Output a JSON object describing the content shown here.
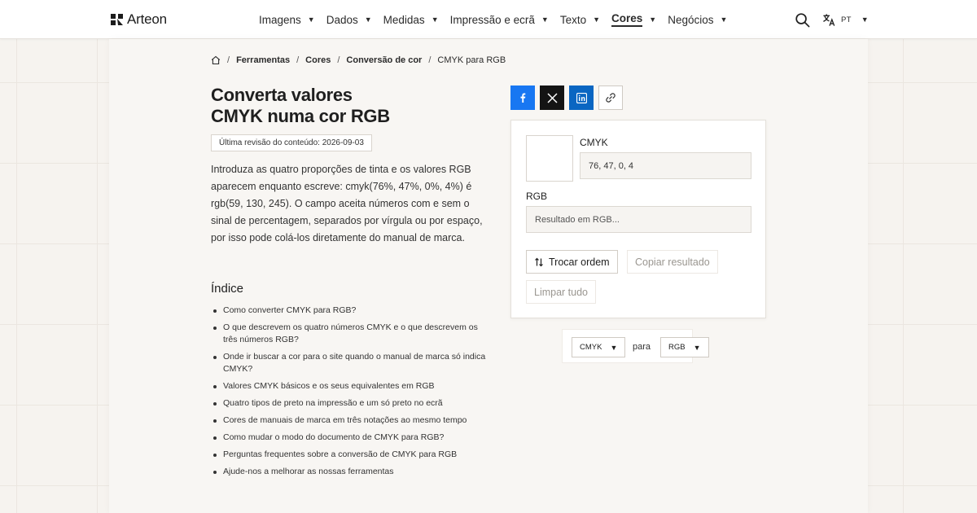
{
  "header": {
    "logo_text": "Arteon",
    "nav": [
      {
        "label": "Imagens"
      },
      {
        "label": "Dados"
      },
      {
        "label": "Medidas"
      },
      {
        "label": "Impressão e ecrã"
      },
      {
        "label": "Texto"
      },
      {
        "label": "Cores",
        "active": true
      },
      {
        "label": "Negócios"
      }
    ],
    "language": "PT"
  },
  "breadcrumb": {
    "items": [
      "Ferramentas",
      "Cores",
      "Conversão de cor"
    ],
    "current": "CMYK para RGB"
  },
  "article": {
    "title_line1": "Converta valores",
    "title_line2": "CMYK numa cor RGB",
    "revision": "Última revisão do conteúdo: 2026-09-03",
    "intro": "Introduza as quatro proporções de tinta e os valores RGB aparecem enquanto escreve: cmyk(76%, 47%, 0%, 4%) é rgb(59, 130, 245). O campo aceita números com e sem o sinal de percentagem, separados por vírgula ou por espaço, por isso pode colá-los diretamente do manual de marca.",
    "toc_title": "Índice",
    "toc": [
      "Como converter CMYK para RGB?",
      "O que descrevem os quatro números CMYK e o que descrevem os três números RGB?",
      "Onde ir buscar a cor para o site quando o manual de marca só indica CMYK?",
      "Valores CMYK básicos e os seus equivalentes em RGB",
      "Quatro tipos de preto na impressão e um só preto no ecrã",
      "Cores de manuais de marca em três notações ao mesmo tempo",
      "Como mudar o modo do documento de CMYK para RGB?",
      "Perguntas frequentes sobre a conversão de CMYK para RGB",
      "Ajude-nos a melhorar as nossas ferramentas"
    ]
  },
  "share": {
    "icons": [
      "facebook-icon",
      "x-icon",
      "linkedin-icon",
      "link-icon"
    ],
    "colors": {
      "facebook": "#1877f2",
      "x": "#141414",
      "linkedin": "#0a66c2"
    }
  },
  "converter": {
    "cmyk_label": "CMYK",
    "cmyk_value": "76, 47, 0, 4",
    "rgb_label": "RGB",
    "rgb_placeholder": "Resultado em RGB...",
    "swap_label": "Trocar ordem",
    "copy_label": "Copiar resultado",
    "clear_label": "Limpar tudo",
    "swatch_color": "#ffffff"
  },
  "format": {
    "from": "CMYK",
    "connector": "para",
    "to": "RGB"
  }
}
